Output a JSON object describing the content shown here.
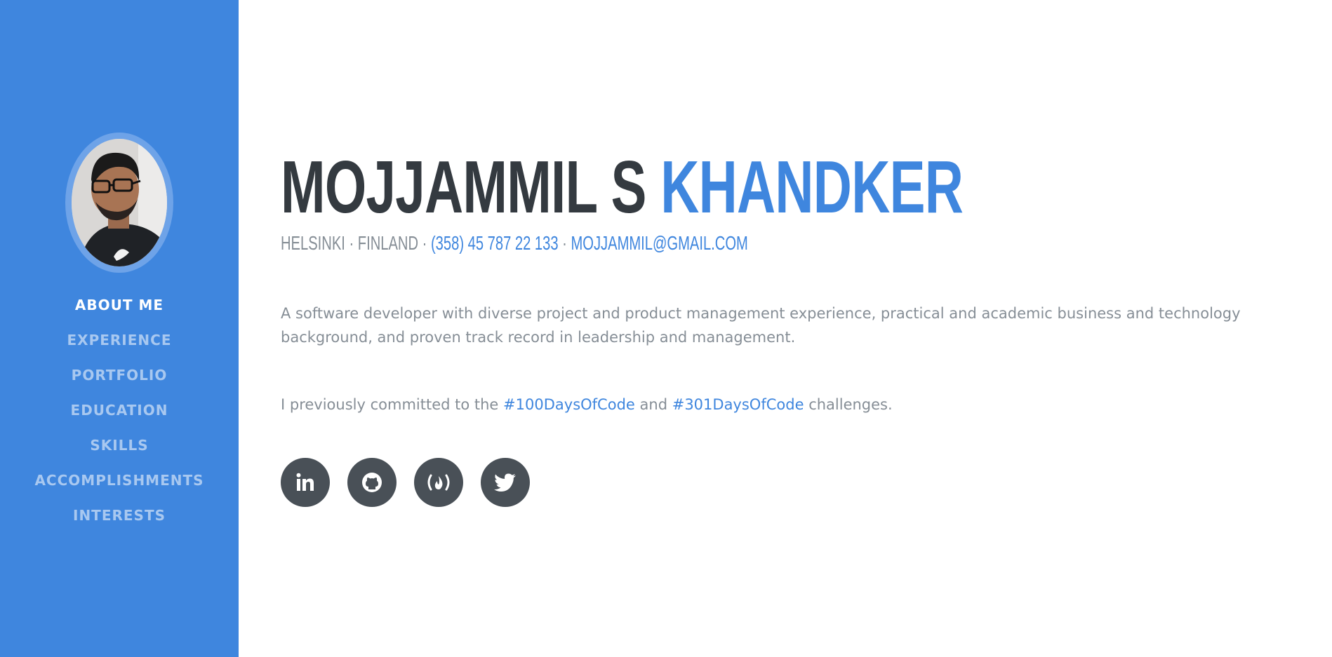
{
  "sidebar": {
    "avatar_alt": "profile photo",
    "nav": [
      {
        "label": "ABOUT ME",
        "active": true
      },
      {
        "label": "EXPERIENCE"
      },
      {
        "label": "PORTFOLIO"
      },
      {
        "label": "EDUCATION"
      },
      {
        "label": "SKILLS"
      },
      {
        "label": "ACCOMPLISHMENTS"
      },
      {
        "label": "INTERESTS"
      }
    ]
  },
  "header": {
    "first_name": "MOJJAMMIL S",
    "last_name": "KHANDKER",
    "location": "HELSINKI · FINLAND ·",
    "phone": "(358) 45 787 22 133",
    "separator": "·",
    "email": "MOJJAMMIL@GMAIL.COM"
  },
  "about": {
    "bio": "A software developer with diverse project and product management experience, practical and academic business and technology background, and proven track record in leadership and management.",
    "challenge_prefix": "I previously committed to the",
    "challenge_1": "#100DaysOfCode",
    "challenge_mid": "and",
    "challenge_2": "#301DaysOfCode",
    "challenge_suffix": "challenges."
  },
  "social": [
    {
      "icon": "linkedin-icon"
    },
    {
      "icon": "github-icon"
    },
    {
      "icon": "freecodecamp-icon"
    },
    {
      "icon": "twitter-icon"
    }
  ],
  "colors": {
    "primary": "#3f86de",
    "dark": "#343a40",
    "muted": "#868e96",
    "social_bg": "#495057"
  }
}
